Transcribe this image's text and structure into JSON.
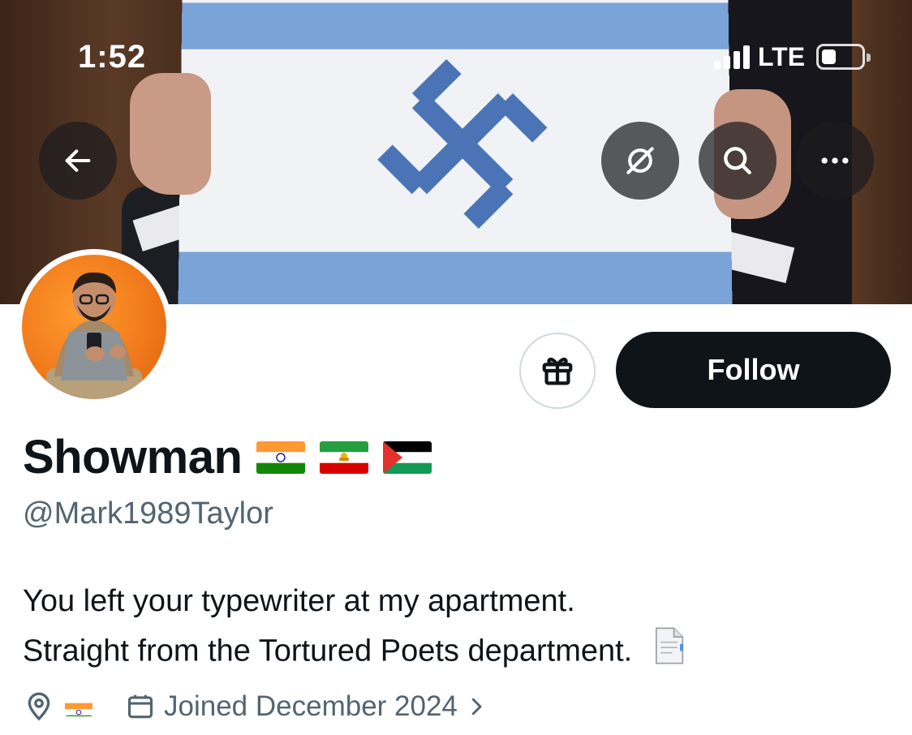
{
  "status_bar": {
    "time": "1:52",
    "network": "LTE",
    "battery_level": 0.35
  },
  "header": {
    "back_icon": "arrow-left-icon",
    "grok_icon": "grok-icon",
    "search_icon": "search-icon",
    "more_icon": "more-horizontal-icon"
  },
  "profile": {
    "display_name": "Showman",
    "name_flags": [
      "india-flag",
      "iran-lion-sun-flag",
      "palestine-flag"
    ],
    "handle": "@Mark1989Taylor",
    "bio_line1": "You left your typewriter at my apartment.",
    "bio_line2": "Straight from the Tortured Poets department.",
    "location_flag": "india-flag",
    "joined": "Joined December 2024"
  },
  "actions": {
    "follow_label": "Follow",
    "gift_icon": "gift-icon"
  },
  "colors": {
    "follow_bg": "#0f1419",
    "secondary_text": "#536471",
    "banner_stripe": "#7aa3d8",
    "symbol": "#4a74b6"
  }
}
